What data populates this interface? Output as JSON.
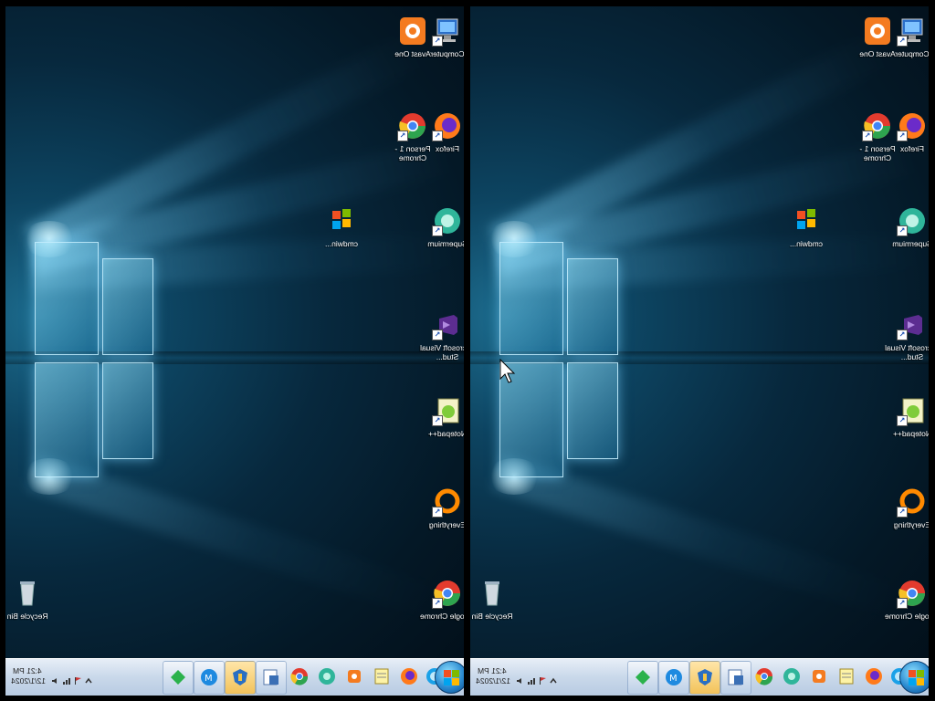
{
  "left_pane": {
    "desktop_icons": [
      {
        "label": "Computer",
        "icon": "computer-icon"
      },
      {
        "label": "Avast One",
        "icon": "avast-icon"
      },
      {
        "label": "Firefox",
        "icon": "firefox-icon"
      },
      {
        "label": "Person 1 - Chrome",
        "icon": "chrome-person-icon"
      },
      {
        "label": "cmdwin...",
        "icon": "windows-flag-icon"
      },
      {
        "label": "Supermium",
        "icon": "supermium-icon"
      },
      {
        "label": "Microsoft Visual Stud...",
        "icon": "visual-studio-icon"
      },
      {
        "label": "Notepad++",
        "icon": "notepadpp-icon"
      },
      {
        "label": "Everything",
        "icon": "everything-icon"
      },
      {
        "label": "Google Chrome",
        "icon": "chrome-icon"
      },
      {
        "label": "Recycle Bin",
        "icon": "recycle-bin-icon"
      }
    ],
    "clock": {
      "time": "4:21 PM",
      "date": "12/1/2024"
    }
  },
  "right_pane": {
    "desktop_icons": [
      {
        "label": "Computer",
        "icon": "computer-icon"
      },
      {
        "label": "Avast One",
        "icon": "avast-icon"
      },
      {
        "label": "Firefox",
        "icon": "firefox-icon"
      },
      {
        "label": "Person 1 - Chrome",
        "icon": "chrome-person-icon"
      },
      {
        "label": "cmdwin...",
        "icon": "windows-flag-icon"
      },
      {
        "label": "Supermium",
        "icon": "supermium-icon"
      },
      {
        "label": "Microsoft Visual Stud...",
        "icon": "visual-studio-icon"
      },
      {
        "label": "Notepad++",
        "icon": "notepadpp-icon"
      },
      {
        "label": "Everything",
        "icon": "everything-icon"
      },
      {
        "label": "Google Chrome",
        "icon": "chrome-icon"
      },
      {
        "label": "Recycle Bin",
        "icon": "recycle-bin-icon"
      }
    ],
    "clock": {
      "time": "4:21 PM",
      "date": "12/1/2024"
    }
  },
  "taskbar_items": [
    "start-orb",
    "edge-icon",
    "firefox-icon",
    "notepad-icon",
    "avast-icon",
    "supermium-icon",
    "chrome-icon",
    "file-explorer-icon",
    "windows-update-icon",
    "maxthon-icon",
    "feedly-icon"
  ],
  "colors": {
    "taskbar": "#c9d8ea",
    "desktop": "#07283d",
    "accent": "#2a8ad0"
  }
}
